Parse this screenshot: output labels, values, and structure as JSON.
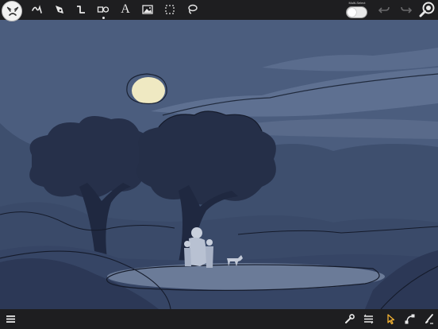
{
  "top_toolbar": {
    "tools": [
      {
        "name": "freehand-pen-tool",
        "icon": "freehand-pen-icon"
      },
      {
        "name": "pen-nib-tool",
        "icon": "pen-nib-icon"
      },
      {
        "name": "line-tool",
        "icon": "line-tool-icon"
      },
      {
        "name": "shape-tool",
        "icon": "shapes-icon",
        "selected": true
      },
      {
        "name": "text-tool",
        "icon": "text-icon",
        "glyph": "A"
      },
      {
        "name": "image-tool",
        "icon": "image-icon"
      },
      {
        "name": "selection-tool",
        "icon": "marquee-select-icon"
      },
      {
        "name": "lasso-tool",
        "icon": "lasso-icon"
      }
    ],
    "multi_select": {
      "label": "Multi-Select",
      "on": false
    },
    "undo_icon": "undo-icon",
    "redo_icon": "redo-icon",
    "zoom_icon": "zoom-icon"
  },
  "bottom_toolbar": {
    "menu_icon": "hamburger-menu-icon",
    "right_tools": [
      "wrench-icon",
      "layers-icon",
      "pointer-select-icon",
      "node-edit-icon",
      "brush-settings-icon"
    ]
  },
  "colors": {
    "toolbar_bg": "#1e1e20",
    "sky": "#4b5d7e",
    "moon": "#efe9c2",
    "pointer_accent": "#f2b233"
  }
}
